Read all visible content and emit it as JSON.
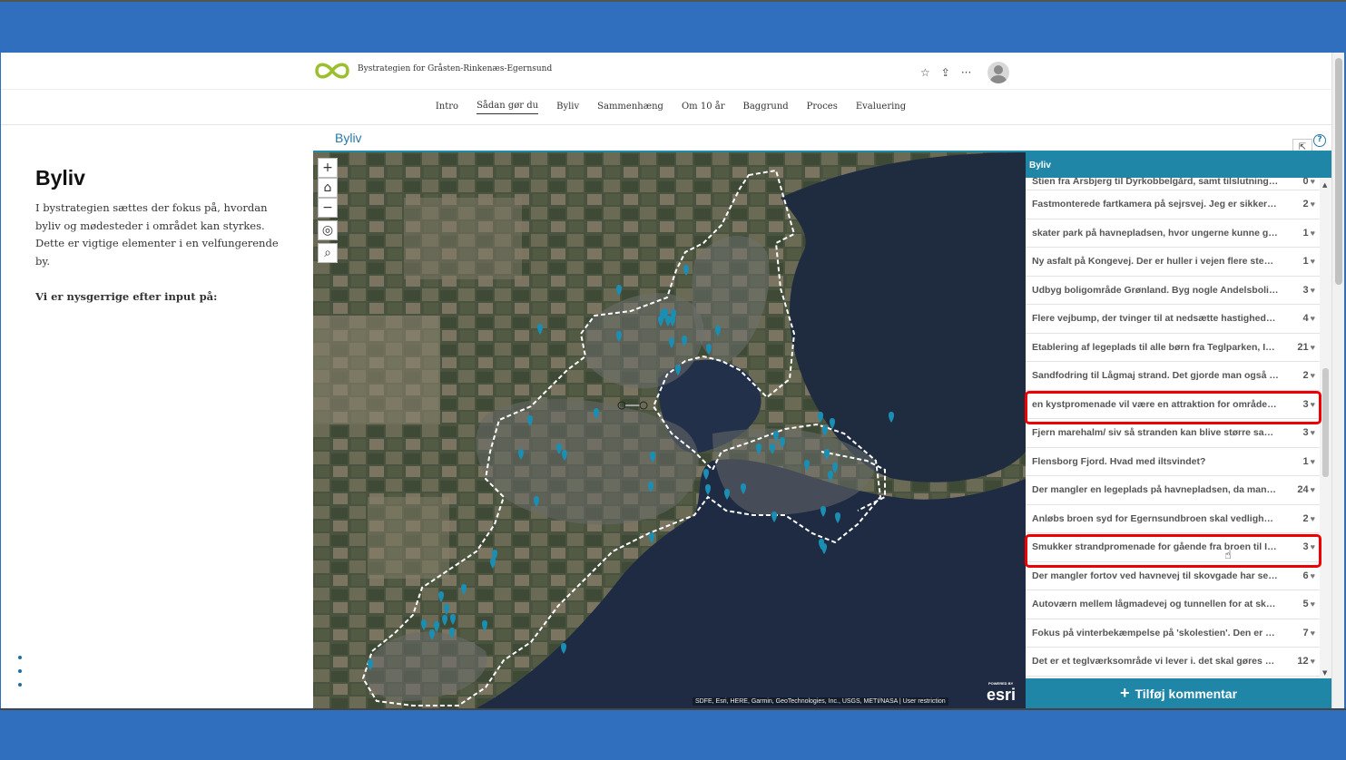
{
  "site": {
    "title": "Bystrategien for Gråsten-Rinkenæs-Egernsund"
  },
  "header": {
    "icons": [
      "star-icon",
      "share-icon",
      "more-icon",
      "avatar-icon"
    ],
    "star": "☆",
    "share": "⇪",
    "more": "···"
  },
  "nav": [
    "Intro",
    "Sådan gør du",
    "Byliv",
    "Sammenhæng",
    "Om 10 år",
    "Baggrund",
    "Proces",
    "Evaluering"
  ],
  "nav_active": "Sådan gør du",
  "left": {
    "heading": "Byliv",
    "body": "I bystrategien sættes der fokus på, hvordan byliv og mødesteder i området kan styrkes. Dette er vigtige elementer i en velfungerende by.",
    "prompt": "Vi er nysgerrige efter input på:"
  },
  "panel": {
    "title": "Byliv",
    "help": "?",
    "expand": "⇱"
  },
  "map": {
    "attribution": "SDFE, Esri, HERE, Garmin, GeoTechnologies, Inc., USGS, METI/NASA | User restriction",
    "esri_label": "esri",
    "esri_powered": "POWERED BY",
    "zoom": [
      "+",
      "⌂",
      "−",
      "◎",
      "⌕"
    ]
  },
  "list": {
    "header": "Byliv",
    "items": [
      {
        "text": "Stien fra Årsbjerg til Dyrkobbelgård, samt tilslutningsst...",
        "count": "0"
      },
      {
        "text": "Fastmonterede fartkamera på sejrsvej. Jeg er sikker på...",
        "count": "2"
      },
      {
        "text": "skater park på havnepladsen, hvor ungerne kunne give...",
        "count": "1"
      },
      {
        "text": "Ny asfalt på Kongevej. Der er huller i vejen flere steder,...",
        "count": "1"
      },
      {
        "text": "Udbyg boligområde Grønland. Byg nogle Andelsbolige...",
        "count": "3"
      },
      {
        "text": "Flere vejbump, der tvinger til at nedsætte hastigheden ...",
        "count": "4"
      },
      {
        "text": "Etablering af legeplads til alle børn fra Teglparken, Isla...",
        "count": "21"
      },
      {
        "text": "Sandfodring til Lågmaj strand. Det gjorde man også for...",
        "count": "2"
      },
      {
        "text": "en kystpromenade vil være en attraktion for området. e...",
        "count": "3"
      },
      {
        "text": "Fjern marehalm/ siv så stranden kan blive større samt ...",
        "count": "3"
      },
      {
        "text": "Flensborg Fjord. Hvad med iltsvindet?",
        "count": "1"
      },
      {
        "text": "Der mangler en legeplads på havnepladsen, da mange ...",
        "count": "24"
      },
      {
        "text": "Anløbs broen syd for Egernsundbroen skal vedlighol...",
        "count": "2"
      },
      {
        "text": "Smukker strandpromenade for gående fra broen til Isla...",
        "count": "3"
      },
      {
        "text": "Der mangler fortov ved havnevej til skovgade har set p...",
        "count": "6"
      },
      {
        "text": "Autoværn mellem lågmadevej og tunnellen for at skær...",
        "count": "5"
      },
      {
        "text": "Fokus på vinterbekæmpelse på 'skolestien'. Den er ofte...",
        "count": "7"
      },
      {
        "text": "Det er et teglværksområde vi lever i. det skal gøres mer...",
        "count": "12"
      }
    ],
    "heart": "♥",
    "add_label": "Tilføj kommentar",
    "add_icon": "+"
  },
  "colors": {
    "brand": "#2f6fbd",
    "accent": "#1f86a8",
    "highlight": "#e00000",
    "pin": "#1a8fb3"
  }
}
